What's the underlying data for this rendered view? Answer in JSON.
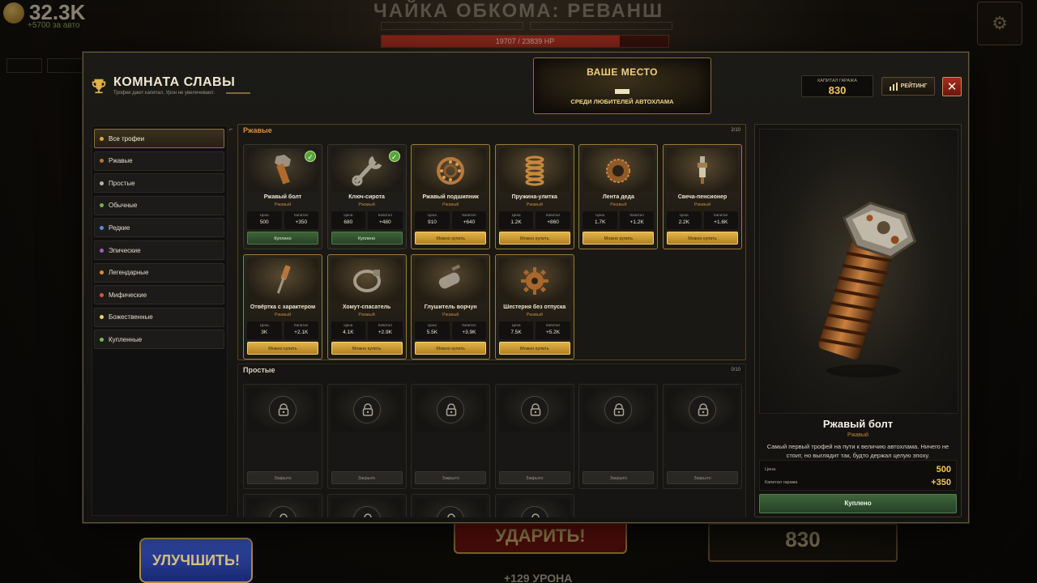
{
  "background": {
    "coins": "32.3K",
    "coins_sub": "+5700 за авто",
    "boss_title": "ЧАЙКА ОБКОМА: РЕВАНШ",
    "hp_text": "19707 / 23839 HP",
    "hp_fraction": 0.83,
    "upgrade_label": "УЛУЧШИТЬ!",
    "hit_label": "УДАРИТЬ!",
    "damage_text": "+129 УРОНА",
    "garage_capital": "830"
  },
  "modal": {
    "title": "КОМНАТА СЛАВЫ",
    "subtitle": "Трофеи дают капитал. Урон не увеличивают.",
    "place_title": "ВАШЕ МЕСТО",
    "place_sub": "СРЕДИ ЛЮБИТЕЛЕЙ АВТОХЛАМА",
    "capital_label": "КАПИТАЛ ГАРАЖА",
    "capital_value": "830",
    "rating_label": "РЕЙТИНГ",
    "close_label": "✕"
  },
  "sidebar": {
    "items": [
      {
        "label": "Все трофеи",
        "color": "#e0a63c"
      },
      {
        "label": "Ржавые",
        "color": "#b7743a"
      },
      {
        "label": "Простые",
        "color": "#b9b5ac"
      },
      {
        "label": "Обычные",
        "color": "#6cb449"
      },
      {
        "label": "Редкие",
        "color": "#4f8ee0"
      },
      {
        "label": "Эпические",
        "color": "#a45ad6"
      },
      {
        "label": "Легендарные",
        "color": "#e58a2b"
      },
      {
        "label": "Мифические",
        "color": "#e0553a"
      },
      {
        "label": "Божественные",
        "color": "#e7d46a"
      },
      {
        "label": "Купленные",
        "color": "#6cc04a"
      }
    ]
  },
  "labels": {
    "price": "Цена",
    "capital": "Капитал",
    "bought": "Куплено",
    "can_buy": "Можно купить",
    "locked": "Закрыто"
  },
  "sections": [
    {
      "title": "Ржавые",
      "count": "2/10",
      "title_color": "#d9913f",
      "cards": [
        {
          "name": "Ржавый болт",
          "rarity": "Ржавый",
          "price": "500",
          "capital": "+350",
          "state": "bought",
          "icon": "bolt-icon"
        },
        {
          "name": "Ключ-сирота",
          "rarity": "Ржавый",
          "price": "680",
          "capital": "+480",
          "state": "bought",
          "icon": "wrench-icon"
        },
        {
          "name": "Ржавый подшипник",
          "rarity": "Ржавый",
          "price": "910",
          "capital": "+640",
          "state": "buy",
          "icon": "bearing-icon"
        },
        {
          "name": "Пружина-улитка",
          "rarity": "Ржавый",
          "price": "1.2K",
          "capital": "+860",
          "state": "buy",
          "icon": "spring-icon"
        },
        {
          "name": "Лента деда",
          "rarity": "Ржавый",
          "price": "1.7K",
          "capital": "+1.2K",
          "state": "buy",
          "icon": "tape-icon"
        },
        {
          "name": "Свеча-пенсионер",
          "rarity": "Ржавый",
          "price": "2.2K",
          "capital": "+1.6K",
          "state": "buy",
          "icon": "spark-plug-icon"
        },
        {
          "name": "Отвёртка с характером",
          "rarity": "Ржавый",
          "price": "3K",
          "capital": "+2.1K",
          "state": "buy",
          "icon": "screwdriver-icon"
        },
        {
          "name": "Хомут-спасатель",
          "rarity": "Ржавый",
          "price": "4.1K",
          "capital": "+2.9K",
          "state": "buy",
          "icon": "clamp-icon"
        },
        {
          "name": "Глушитель ворчун",
          "rarity": "Ржавый",
          "price": "5.5K",
          "capital": "+3.9K",
          "state": "buy",
          "icon": "muffler-icon"
        },
        {
          "name": "Шестерня без отпуска",
          "rarity": "Ржавый",
          "price": "7.5K",
          "capital": "+5.2K",
          "state": "buy",
          "icon": "gear-icon"
        }
      ]
    },
    {
      "title": "Простые",
      "count": "0/10",
      "title_color": "#d9d2c2",
      "locked_count": 10
    }
  ],
  "detail": {
    "name": "Ржавый болт",
    "rarity": "Ржавый",
    "description": "Самый первый трофей на пути к величию автохлама. Ничего не стоит, но выглядит так, будто держал целую эпоху.",
    "price_label": "Цена",
    "price": "500",
    "capital_label": "Капитал гаража",
    "capital": "+350",
    "button": "Куплено"
  }
}
